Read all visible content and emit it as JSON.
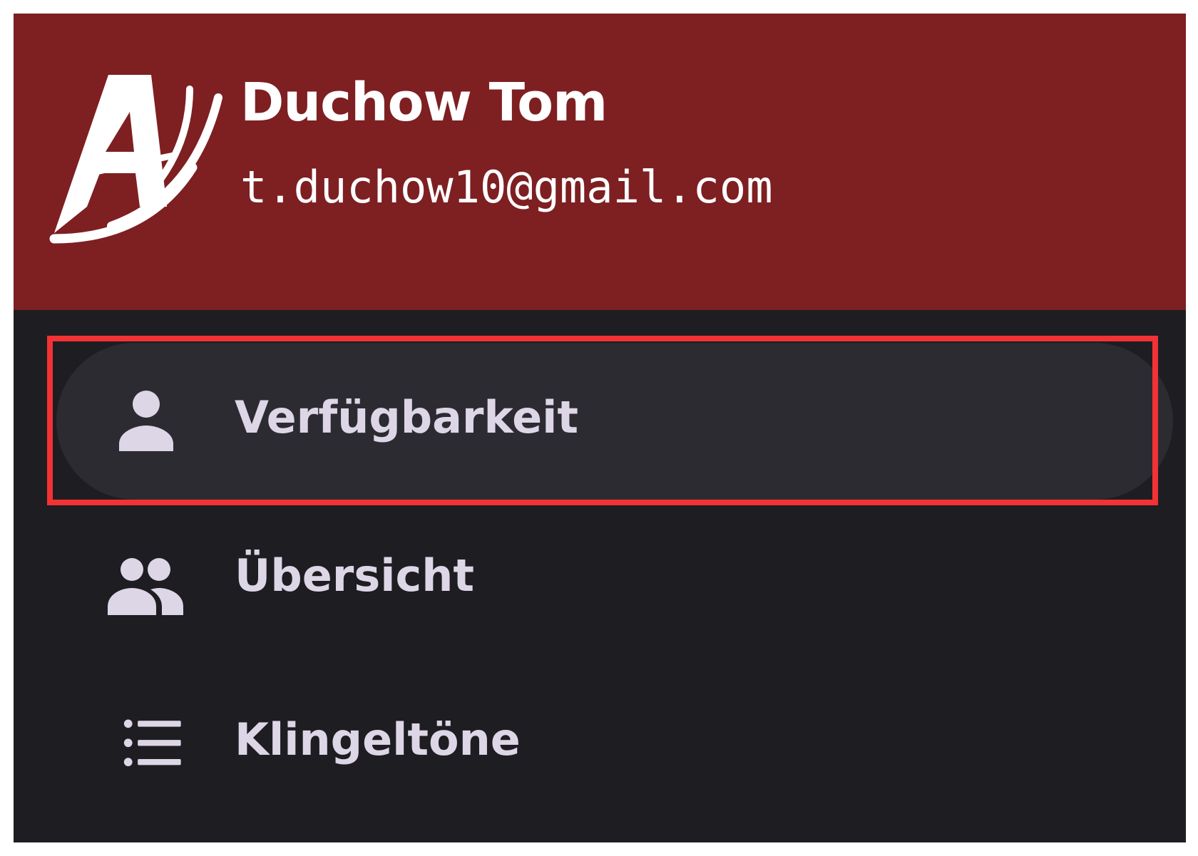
{
  "header": {
    "user_name": "Duchow Tom",
    "user_email": "t.duchow10@gmail.com",
    "logo_icon": "app-logo-a",
    "background_color": "#7e1f22"
  },
  "menu": {
    "items": [
      {
        "label": "Verfügbarkeit",
        "icon": "person-icon",
        "selected": true
      },
      {
        "label": "Übersicht",
        "icon": "people-icon",
        "selected": false
      },
      {
        "label": "Klingeltöne",
        "icon": "list-icon",
        "selected": false
      }
    ],
    "background_color": "#1e1d22",
    "selected_color": "#2d2b32",
    "text_color": "#ddd6e6"
  },
  "annotation": {
    "highlight_color": "#f23234"
  }
}
